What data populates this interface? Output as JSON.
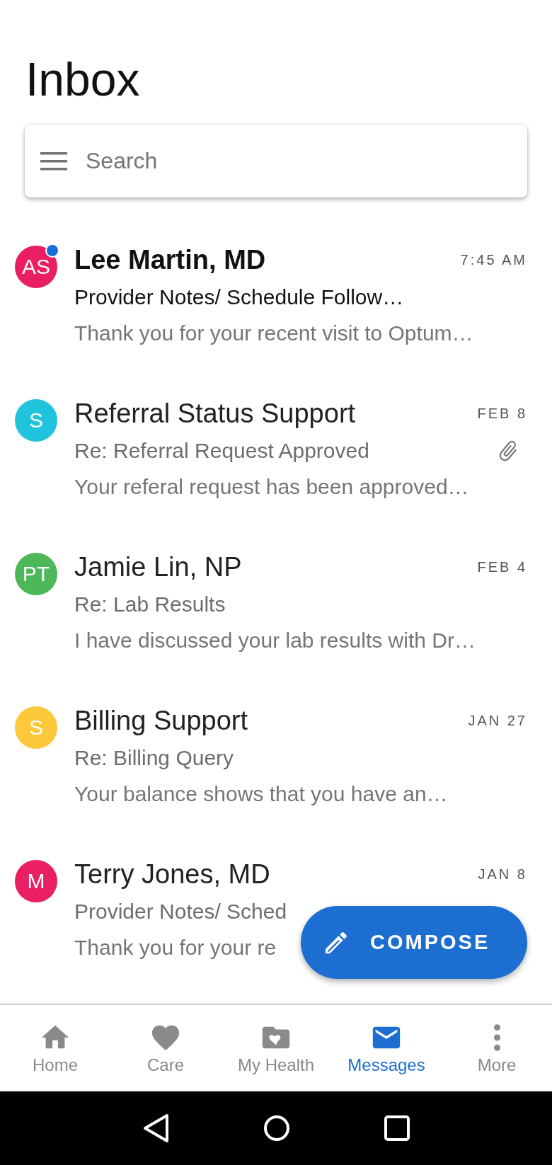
{
  "title": "Inbox",
  "search": {
    "placeholder": "Search"
  },
  "messages": [
    {
      "initials": "AS",
      "color": "#e91e63",
      "unread": true,
      "sender": "Lee Martin, MD",
      "time": "7:45 AM",
      "subject": "Provider Notes/ Schedule Follow…",
      "preview": "Thank you for your recent visit to Optum…",
      "attachment": false
    },
    {
      "initials": "S",
      "color": "#1fc3dc",
      "unread": false,
      "sender": "Referral Status Support",
      "time": "FEB 8",
      "subject": "Re: Referral Request Approved",
      "preview": "Your referal request has been approved…",
      "attachment": true
    },
    {
      "initials": "PT",
      "color": "#4cb85a",
      "unread": false,
      "sender": "Jamie Lin, NP",
      "time": "FEB 4",
      "subject": "Re: Lab Results",
      "preview": "I have discussed your lab results with Dr…",
      "attachment": false
    },
    {
      "initials": "S",
      "color": "#fdc93a",
      "unread": false,
      "sender": "Billing Support",
      "time": "JAN 27",
      "subject": "Re: Billing Query",
      "preview": "Your balance shows that you have an…",
      "attachment": false
    },
    {
      "initials": "M",
      "color": "#e91e63",
      "unread": false,
      "sender": "Terry Jones, MD",
      "time": "JAN 8",
      "subject": "Provider Notes/ Sched",
      "preview": "Thank you for your re",
      "attachment": false
    }
  ],
  "compose": {
    "label": "COMPOSE"
  },
  "nav": [
    {
      "kind": "home",
      "label": "Home",
      "selected": false
    },
    {
      "kind": "care",
      "label": "Care",
      "selected": false
    },
    {
      "kind": "health",
      "label": "My Health",
      "selected": false
    },
    {
      "kind": "messages",
      "label": "Messages",
      "selected": true
    },
    {
      "kind": "more",
      "label": "More",
      "selected": false
    }
  ]
}
